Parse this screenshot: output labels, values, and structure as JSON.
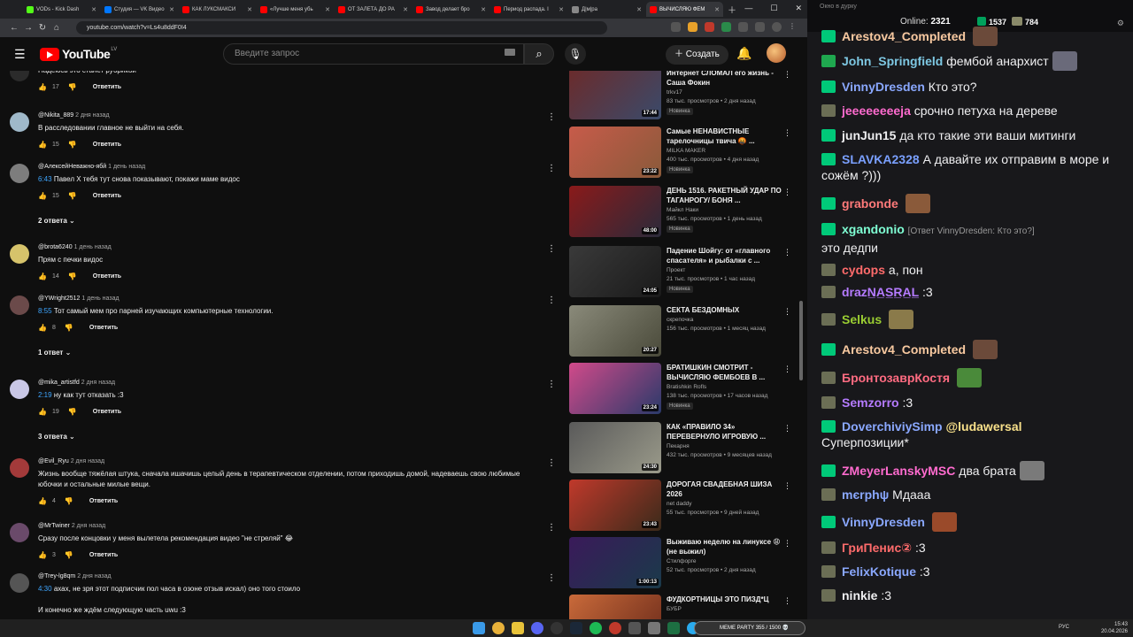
{
  "browser": {
    "tabs": [
      {
        "label": "VODs - Kick Dash"
      },
      {
        "label": "Студия — VK Видео"
      },
      {
        "label": "КАК ЛУКСМАКСИ"
      },
      {
        "label": "«Лучше меня убь"
      },
      {
        "label": "ОТ ЗАЛЕТА ДО РА"
      },
      {
        "label": "Завод делает бро"
      },
      {
        "label": "Период распада. I"
      },
      {
        "label": "Д|м|ра"
      },
      {
        "label": "ВЫЧИСЛЯЮ ФЕМ"
      }
    ],
    "url": "youtube.com/watch?v=Ls4u8ddF0I4"
  },
  "youtube": {
    "logo_text": "YouTube",
    "country_code": "LV",
    "search_placeholder": "Введите запрос",
    "create_label": "Создать"
  },
  "comments": [
    {
      "author": "",
      "date": "",
      "text": "Надеюсь это станет рубрикой",
      "ts": "",
      "likes": "17",
      "reply_label": "Ответить",
      "avatar_color": "#2b2b2b"
    },
    {
      "author": "@Nikita_889",
      "date": "2 дня назад",
      "text": "В расследовании главное не выйти на себя.",
      "ts": "",
      "likes": "15",
      "reply_label": "Ответить",
      "avatar_color": "#9fb8c9"
    },
    {
      "author": "@АлексейНеважно-ябй",
      "date": "1 день назад",
      "text": "Павел Х тебя тут снова показывают, покажи маме видос",
      "ts": "6:43",
      "likes": "15",
      "reply_label": "Ответить",
      "avatar_color": "#7d7d7d",
      "replies": "2 ответа"
    },
    {
      "author": "@brota6240",
      "date": "1 день назад",
      "text": "Прям с печки видос",
      "ts": "",
      "likes": "14",
      "reply_label": "Ответить",
      "avatar_color": "#d6c36b"
    },
    {
      "author": "@YWright2512",
      "date": "1 день назад",
      "text": "Тот самый мем про парней изучающих компьютерные технологии.",
      "ts": "8:55",
      "likes": "8",
      "reply_label": "Ответить",
      "avatar_color": "#6b4a4a",
      "replies": "1 ответ"
    },
    {
      "author": "@mika_artistfd",
      "date": "2 дня назад",
      "text": "ну как тут отказать :3",
      "ts": "2:19",
      "likes": "19",
      "reply_label": "Ответить",
      "avatar_color": "#c9c7e6",
      "replies": "3 ответа"
    },
    {
      "author": "@Evil_Ryu",
      "date": "2 дня назад",
      "text": "Жизнь вообще тяжёлая штука, сначала ишачишь целый день в терапевтическом отделении, потом приходишь домой, надеваешь свою любимые юбочки и остальные милые вещи.",
      "ts": "",
      "likes": "4",
      "reply_label": "Ответить",
      "avatar_color": "#a33a3a"
    },
    {
      "author": "@MrTwiner",
      "date": "2 дня назад",
      "text": "Сразу после концовки у меня вылетела рекомендация видео \"не стреляй\" 😂",
      "ts": "",
      "likes": "3",
      "reply_label": "Ответить",
      "avatar_color": "#6a4a6a"
    },
    {
      "author": "@Trey-lg8qm",
      "date": "2 дня назад",
      "text": "ахах, не зря этот подписчик пол часа в озоне  отзыв искал) оно того стоило",
      "ts": "4:30",
      "text2": "И конечно же ждём следующую часть uwu :3",
      "avatar_color": "#555555"
    }
  ],
  "videos": [
    {
      "title": "Интернет СЛОМАЛ его жизнь - Саша Фокин",
      "channel": "trkv17",
      "meta": "83 тыс. просмотров • 2 дня назад",
      "badge": "Новинка",
      "duration": "17:44",
      "thumb_a": "#6b2b2b",
      "thumb_b": "#3a4a6a"
    },
    {
      "title": "Самые НЕНАВИСТНЫЕ тарелочницы твича 🤬 ...",
      "channel": "MILKA MAKER",
      "meta": "400 тыс. просмотров • 4 дня назад",
      "badge": "Новинка",
      "duration": "23:22",
      "thumb_a": "#c75b4a",
      "thumb_b": "#8a5a3a"
    },
    {
      "title": "ДЕНЬ 1516. РАКЕТНЫЙ УДАР ПО ТАГАНРОГУ/ БОНЯ ...",
      "channel": "Майкл Наки",
      "meta": "565 тыс. просмотров • 1 день назад",
      "badge": "Новинка",
      "duration": "48:00",
      "thumb_a": "#8a1a1a",
      "thumb_b": "#2a2a3a"
    },
    {
      "title": "Падение Шойгу: от «главного спасателя» и рыбалки с ...",
      "channel": "Проект",
      "meta": "21 тыс. просмотров • 1 час назад",
      "badge": "Новинка",
      "duration": "24:05",
      "thumb_a": "#3a3a3a",
      "thumb_b": "#1a1a1a"
    },
    {
      "title": "СЕКТА БЕЗДОМНЫХ",
      "channel": "скрепочка",
      "meta": "156 тыс. просмотров • 1 месяц назад",
      "badge": "",
      "duration": "20:27",
      "thumb_a": "#8a8a7a",
      "thumb_b": "#4a4a3a"
    },
    {
      "title": "БРАТИШКИН СМОТРИТ - ВЫЧИСЛЯЮ ФЕМБОЕВ В ...",
      "channel": "Bratishkin Rofls",
      "meta": "138 тыс. просмотров • 17 часов назад",
      "badge": "Новинка",
      "duration": "23:24",
      "thumb_a": "#d14a8a",
      "thumb_b": "#2a3a6a"
    },
    {
      "title": "КАК «ПРАВИЛО 34» ПЕРЕВЕРНУЛО ИГРОВУЮ ...",
      "channel": "Пекарня",
      "meta": "432 тыс. просмотров • 9 месяцев назад",
      "badge": "",
      "duration": "24:30",
      "thumb_a": "#5a5a5a",
      "thumb_b": "#9a9a8a"
    },
    {
      "title": "ДОРОГАЯ СВАДЕБНАЯ ШИЗА 2026",
      "channel": "net daddy",
      "meta": "55 тыс. просмотров • 9 дней назад",
      "badge": "",
      "duration": "23:43",
      "thumb_a": "#c0392b",
      "thumb_b": "#3a2a1a"
    },
    {
      "title": "Выживаю неделю на линуксе 😩 (не выжил)",
      "channel": "Стилфорге",
      "meta": "52 тыс. просмотров • 2 дня назад",
      "badge": "",
      "duration": "1:00:13",
      "thumb_a": "#3a1a5a",
      "thumb_b": "#1a3a4a"
    },
    {
      "title": "ФУДКОРТНИЦЫ ЭТО ПИЗД*Ц",
      "channel": "БУБР",
      "meta": "",
      "badge": "",
      "duration": "",
      "thumb_a": "#c96a3a",
      "thumb_b": "#6a2a1a"
    }
  ],
  "chat_panel": {
    "top_text": "Окно в дурку",
    "online_label": "Online:",
    "online_count": "2321",
    "count1": "1537",
    "count2": "784"
  },
  "chat": [
    {
      "icon": "green",
      "user": "Arestov4_Completed",
      "color": "#f8c9a0",
      "text": "",
      "emote": "#6b4a3a"
    },
    {
      "icon": "mod",
      "user": "John_Springfield",
      "color": "#7ec8e3",
      "text": "фембой анархист",
      "emote": "#6a6a7a"
    },
    {
      "icon": "green",
      "user": "VinnyDresden",
      "color": "#8aa8ff",
      "text": "Кто это?",
      "emote": ""
    },
    {
      "icon": "glasses",
      "user": "jeeeeeeeeja",
      "color": "#ff6bcf",
      "text": "срочно петуха на дереве",
      "emote": ""
    },
    {
      "icon": "green",
      "user": "junJun15",
      "color": "#efeff1",
      "text": "да кто такие эти ваши митинги",
      "emote": ""
    },
    {
      "icon": "green",
      "user": "SLAVKA2328",
      "color": "#7aa0ff",
      "text": "А давайте их отправим в море и сожём ?)))",
      "emote": ""
    },
    {
      "icon": "green",
      "user": "grabonde",
      "color": "#ff7a7a",
      "text": "",
      "emote": "#8a5a3a"
    },
    {
      "icon": "green",
      "user": "xgandonio",
      "color": "#7fffd4",
      "replyto": "[Ответ VinnyDresden: Кто это?]",
      "text": "это дедпи",
      "emote": ""
    },
    {
      "icon": "glasses",
      "user": "cydops",
      "color": "#ff6b6b",
      "text": "а, пон",
      "emote": ""
    },
    {
      "icon": "glasses",
      "user": "drazN̲A̲S̲R̲A̲L̲",
      "color": "#b57bff",
      "text": ":3",
      "emote": ""
    },
    {
      "icon": "glasses",
      "user": "Selkus",
      "color": "#9acd32",
      "text": "",
      "emote": "#8a7a4a"
    },
    {
      "icon": "green",
      "user": "Arestov4_Completed",
      "color": "#f8c9a0",
      "text": "",
      "emote": "#6b4a3a"
    },
    {
      "icon": "glasses",
      "user": "БронтозаврКостя",
      "color": "#ff6b81",
      "text": "",
      "emote": "#4a8a3a"
    },
    {
      "icon": "glasses",
      "user": "Semzorro",
      "color": "#b57bff",
      "text": ":3",
      "emote": ""
    },
    {
      "icon": "green",
      "user": "DoverchiviySimp",
      "color": "#8aa8ff",
      "mention": "@ludawersal",
      "text": "Суперпозиции*",
      "emote": ""
    },
    {
      "icon": "green",
      "user": "ZMeyerLanskyMSC",
      "color": "#ff6bcf",
      "text": "два брата",
      "emote": "#7a7a7a"
    },
    {
      "icon": "glasses",
      "user": "mєrphψ",
      "color": "#8aa8ff",
      "text": "Мдааа",
      "emote": ""
    },
    {
      "icon": "green",
      "user": "VinnyDresden",
      "color": "#8aa8ff",
      "text": "",
      "emote": "#9a4a2a"
    },
    {
      "icon": "glasses",
      "user": "ГриПенис②",
      "color": "#ff6b6b",
      "text": ":3",
      "emote": ""
    },
    {
      "icon": "glasses",
      "user": "FelixKotique",
      "color": "#8aa8ff",
      "text": ":3",
      "emote": ""
    },
    {
      "icon": "glasses",
      "user": "ninkie",
      "color": "#efeff1",
      "text": ":3",
      "emote": ""
    }
  ],
  "taskbar": {
    "lang": "РУС",
    "time": "15:43",
    "date": "20.04.2026",
    "meme_title": "MEME PARTY",
    "meme_count": "355 / 1500 💀"
  }
}
